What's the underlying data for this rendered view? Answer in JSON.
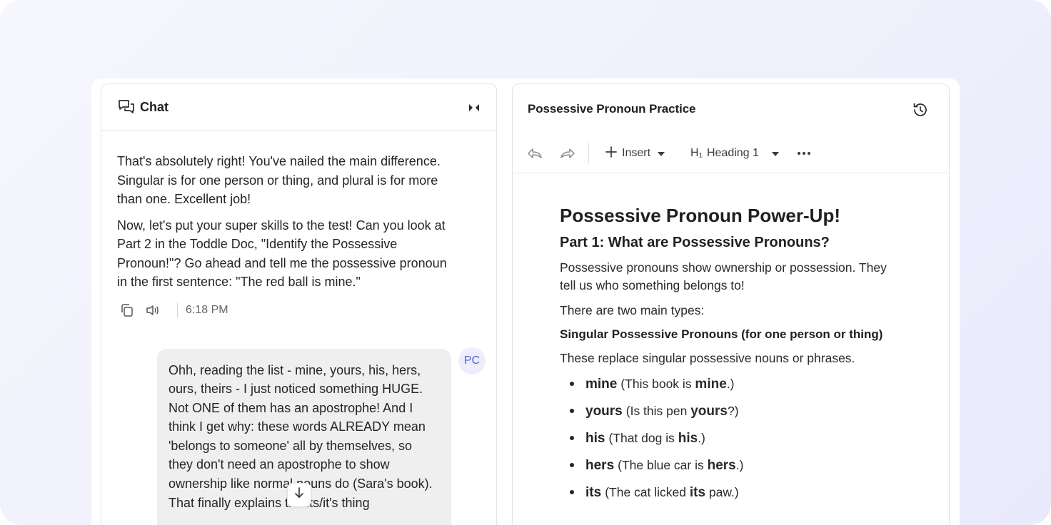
{
  "chat": {
    "title": "Chat",
    "bot_message": {
      "paragraphs": [
        "That's absolutely right! You've nailed the main difference. Singular is for one person or thing, and plural is for more than one. Excellent job!",
        "Now, let's put your super skills to the test! Can you look at Part 2 in the Toddle Doc, \"Identify the Possessive Pronoun!\"? Go ahead and tell me the possessive pronoun in the first sentence: \"The red ball is mine.\""
      ],
      "time": "6:18 PM"
    },
    "user_message": {
      "avatar_initials": "PC",
      "text": "Ohh, reading the list - mine, yours, his, hers, ours, theirs - I just noticed something HUGE. Not ONE of them has an apostrophe! And I think I get why: these words ALREADY mean 'belongs to someone' all by themselves, so they don't need an apostrophe to show ownership like normal nouns do (Sara's book). That finally explains the its/it's thing"
    }
  },
  "doc": {
    "title": "Possessive Pronoun Practice",
    "toolbar": {
      "insert_label": "Insert",
      "heading_label": "Heading 1",
      "heading_glyph": "H₁"
    },
    "content": {
      "h1": "Possessive Pronoun Power-Up!",
      "h2": "Part 1: What are Possessive Pronouns?",
      "intro": "Possessive pronouns show ownership or possession. They tell us who something belongs to!",
      "types_intro": "There are two main types:",
      "h3": "Singular Possessive Pronouns (for one person or thing)",
      "singular_desc": "These replace singular possessive nouns or phrases.",
      "list": [
        {
          "word": "mine",
          "pre": "(This book is ",
          "bold": "mine",
          "post": ".)"
        },
        {
          "word": "yours",
          "pre": "(Is this pen ",
          "bold": "yours",
          "post": "?)"
        },
        {
          "word": "his",
          "pre": "(That dog is ",
          "bold": "his",
          "post": ".)"
        },
        {
          "word": "hers",
          "pre": "(The blue car is ",
          "bold": "hers",
          "post": ".)"
        },
        {
          "word": "its",
          "pre": "(The cat licked ",
          "bold": "its",
          "post": " paw.)"
        }
      ]
    }
  },
  "colors": {
    "accent": "#5a5fd6",
    "avatar_bg": "#eceefc",
    "user_bubble": "#efefef",
    "backdrop": "#f0f1fc"
  },
  "icons": {
    "chat": "chat-bubbles-icon",
    "collapse": "collapse-panel-icon",
    "copy": "copy-icon",
    "speaker": "speaker-icon",
    "scroll_down": "arrow-down-icon",
    "history": "history-icon",
    "undo": "undo-icon",
    "redo": "redo-icon",
    "insert": "plus-icon",
    "dropdown": "caret-down-icon",
    "more": "more-horizontal-icon"
  }
}
